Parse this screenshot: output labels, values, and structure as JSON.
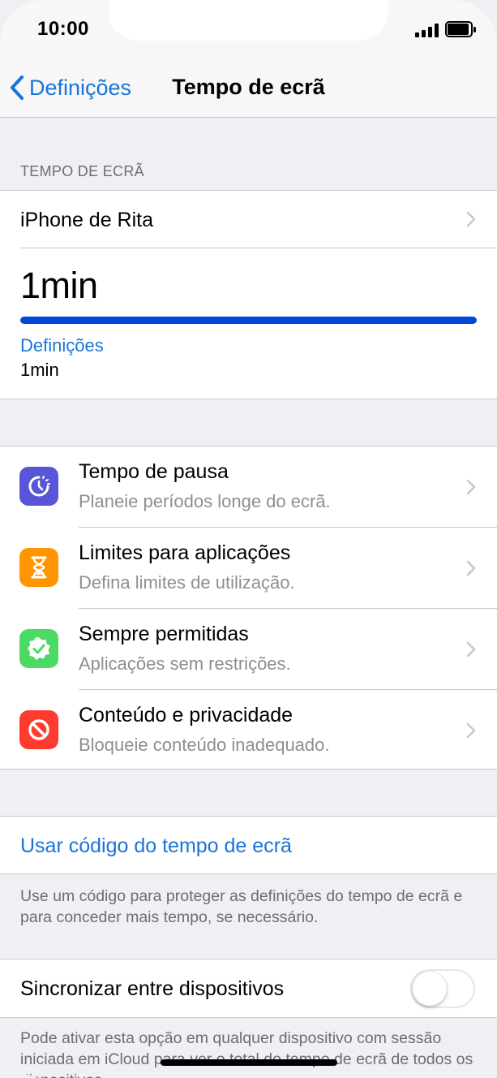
{
  "status_bar": {
    "time": "10:00"
  },
  "nav": {
    "back_label": "Definições",
    "title": "Tempo de ecrã"
  },
  "screen_time": {
    "section_header": "TEMPO DE ECRÃ",
    "device_label": "iPhone de Rita",
    "total_time": "1min",
    "usage_bar_fraction": 1.0,
    "usage_bar_color": "#0047d6",
    "category_label": "Definições",
    "category_time": "1min"
  },
  "features": [
    {
      "title": "Tempo de pausa",
      "subtitle": "Planeie períodos longe do ecrã.",
      "icon": "downtime-icon",
      "color": "#5856d6"
    },
    {
      "title": "Limites para aplicações",
      "subtitle": "Defina limites de utilização.",
      "icon": "hourglass-icon",
      "color": "#ff9500"
    },
    {
      "title": "Sempre permitidas",
      "subtitle": "Aplicações sem restrições.",
      "icon": "checkmark-badge-icon",
      "color": "#4cd964"
    },
    {
      "title": "Conteúdo e privacidade",
      "subtitle": "Bloqueie conteúdo inadequado.",
      "icon": "prohibited-icon",
      "color": "#ff3b30"
    }
  ],
  "passcode": {
    "link_label": "Usar código do tempo de ecrã",
    "footer": "Use um código para proteger as definições do tempo de ecrã e para conceder mais tempo, se necessário."
  },
  "sync": {
    "label": "Sincronizar entre dispositivos",
    "enabled": false,
    "footer": "Pode ativar esta opção em qualquer dispositivo com sessão iniciada em iCloud para ver o total do tempo de ecrã de todos os dispositivos."
  },
  "colors": {
    "accent": "#1a73d9",
    "background": "#efeff4"
  }
}
